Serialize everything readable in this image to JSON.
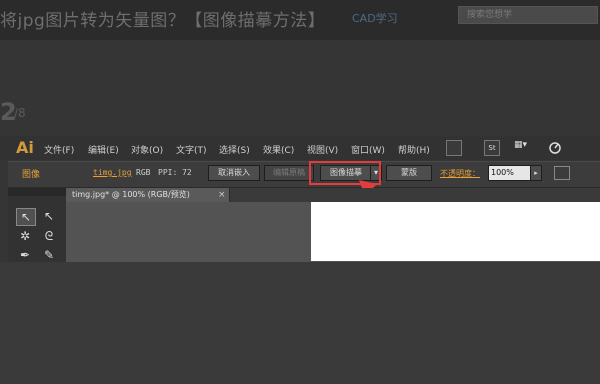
{
  "page": {
    "title": "将jpg图片转为矢量图？【图像描摹方法】",
    "title_suffix": "CAD学习",
    "search_placeholder": "搜索您想学",
    "step_number": "2",
    "step_sub": "/8",
    "step_number2": "2"
  },
  "app": {
    "logo": "Ai",
    "menu": [
      "文件(F)",
      "编辑(E)",
      "对象(O)",
      "文字(T)",
      "选择(S)",
      "效果(C)",
      "视图(V)",
      "窗口(W)",
      "帮助(H)"
    ],
    "toolbar_icons": [
      "bridge-icon",
      "stock-icon",
      "arrange-icon",
      "gpu-icon"
    ],
    "st_label": "St",
    "arrange_label": "▦▾"
  },
  "control_bar": {
    "label": "图像",
    "file_link": "timg.jpg",
    "color_mode": "RGB",
    "ppi": "PPI: 72",
    "cancel_embed": "取消嵌入",
    "edit_original": "编辑原稿",
    "image_trace": "图像描摹",
    "image_trace_drop": "▾",
    "mask": "蒙版",
    "opacity_label": "不透明度：",
    "opacity_value": "100%",
    "opacity_arrow": "▸"
  },
  "document": {
    "tab_label": "timg.jpg* @ 100% (RGB/预览)",
    "tab_close": "×"
  },
  "tools": {
    "select": "↖",
    "direct_select": "↖",
    "magic_wand": "✲",
    "lasso": "ᘓ",
    "pen": "✒",
    "curvature": "✎"
  },
  "colors": {
    "accent_orange": "#e8a037",
    "highlight_red": "#e23c3c",
    "panel_dark": "#323232"
  }
}
